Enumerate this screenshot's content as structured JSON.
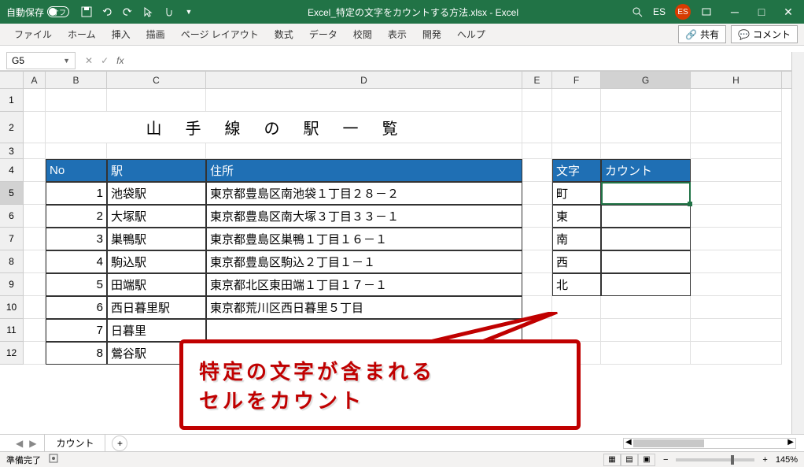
{
  "titlebar": {
    "autosave_label": "自動保存",
    "autosave_state": "オフ",
    "filename": "Excel_特定の文字をカウントする方法.xlsx - Excel",
    "user_initials": "ES",
    "user_badge": "ES"
  },
  "ribbon": {
    "tabs": [
      "ファイル",
      "ホーム",
      "挿入",
      "描画",
      "ページ レイアウト",
      "数式",
      "データ",
      "校閲",
      "表示",
      "開発",
      "ヘルプ"
    ],
    "share": "共有",
    "comment": "コメント"
  },
  "formula_bar": {
    "name_box": "G5",
    "fx": "fx",
    "value": ""
  },
  "columns": [
    "A",
    "B",
    "C",
    "D",
    "E",
    "F",
    "G",
    "H"
  ],
  "rows": [
    "1",
    "2",
    "3",
    "4",
    "5",
    "6",
    "7",
    "8",
    "9",
    "10",
    "11",
    "12"
  ],
  "sheet_title": "山手線の駅一覧",
  "table1": {
    "headers": [
      "No",
      "駅",
      "住所"
    ],
    "rows": [
      {
        "no": "1",
        "station": "池袋駅",
        "addr": "東京都豊島区南池袋１丁目２８－２"
      },
      {
        "no": "2",
        "station": "大塚駅",
        "addr": "東京都豊島区南大塚３丁目３３－１"
      },
      {
        "no": "3",
        "station": "巣鴨駅",
        "addr": "東京都豊島区巣鴨１丁目１６－１"
      },
      {
        "no": "4",
        "station": "駒込駅",
        "addr": "東京都豊島区駒込２丁目１－１"
      },
      {
        "no": "5",
        "station": "田端駅",
        "addr": "東京都北区東田端１丁目１７－１"
      },
      {
        "no": "6",
        "station": "西日暮里駅",
        "addr": "東京都荒川区西日暮里５丁目"
      },
      {
        "no": "7",
        "station": "日暮里",
        "addr": ""
      },
      {
        "no": "8",
        "station": "鶯谷駅",
        "addr": ""
      }
    ]
  },
  "table2": {
    "headers": [
      "文字",
      "カウント"
    ],
    "rows": [
      {
        "char": "町",
        "count": ""
      },
      {
        "char": "東",
        "count": ""
      },
      {
        "char": "南",
        "count": ""
      },
      {
        "char": "西",
        "count": ""
      },
      {
        "char": "北",
        "count": ""
      }
    ]
  },
  "callout": {
    "line1": "特定の文字が含まれる",
    "line2": "セルをカウント"
  },
  "sheet_tabs": {
    "active": "カウント"
  },
  "statusbar": {
    "ready": "準備完了",
    "zoom": "145%"
  }
}
